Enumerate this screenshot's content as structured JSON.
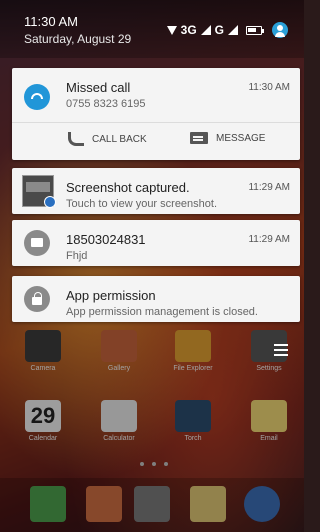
{
  "status_bar": {
    "time": "11:30 AM",
    "date": "Saturday, August 29",
    "network": "3G",
    "network2": "G"
  },
  "notifications": [
    {
      "title": "Missed call",
      "subtitle": "0755 8323 6195",
      "time": "11:30 AM",
      "icon": "missed-call-icon",
      "actions": [
        "CALL BACK",
        "MESSAGE"
      ]
    },
    {
      "title": "Screenshot captured.",
      "subtitle": "Touch to view your screenshot.",
      "time": "11:29 AM",
      "icon": "screenshot-thumbnail"
    },
    {
      "title": "18503024831",
      "subtitle": "Fhjd",
      "time": "11:29 AM",
      "icon": "message-icon"
    },
    {
      "title": "App permission",
      "subtitle": "App permission management is closed.",
      "time": "",
      "icon": "lock-icon"
    }
  ],
  "home_apps_row1": [
    "Camera",
    "Gallery",
    "File Explorer",
    "Settings"
  ],
  "home_apps_row2": [
    "Calendar",
    "Calculator",
    "Torch",
    "Email"
  ],
  "calendar_day": "29",
  "colors": {
    "accent": "#2196d8",
    "card_bg": "#f4f4f4"
  }
}
